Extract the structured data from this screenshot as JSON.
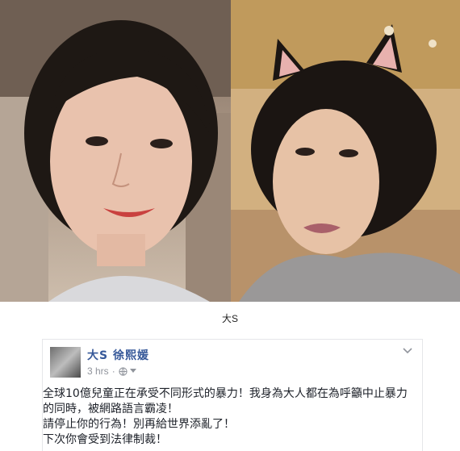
{
  "caption": "大S",
  "post": {
    "author": "大S 徐熙媛",
    "time": "3 hrs",
    "separator": "·",
    "lines": [
      "全球10億兒童正在承受不同形式的暴力！我身為大人都在為呼籲中止暴力",
      "的同時，被網路語言霸凌！",
      "請停止你的行為！別再給世界添亂了！",
      "下次你會受到法律制裁！"
    ]
  }
}
